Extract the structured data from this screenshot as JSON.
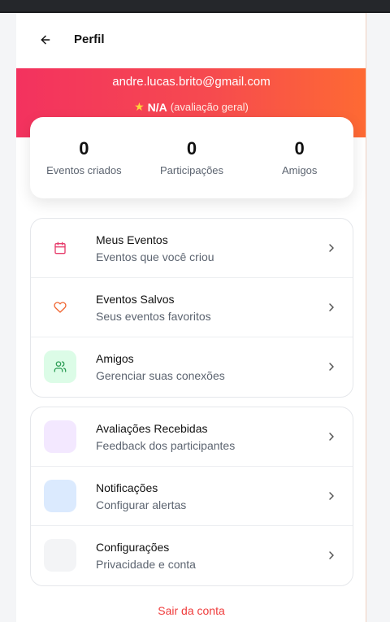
{
  "header": {
    "title": "Perfil",
    "back_icon": "arrow-left-icon"
  },
  "profile": {
    "email": "andre.lucas.brito@gmail.com",
    "rating_value": "N/A",
    "rating_label": "(avaliação geral)"
  },
  "stats": [
    {
      "value": "0",
      "label": "Eventos criados"
    },
    {
      "value": "0",
      "label": "Participações"
    },
    {
      "value": "0",
      "label": "Amigos"
    }
  ],
  "menu_group_1": [
    {
      "title": "Meus Eventos",
      "subtitle": "Eventos que você criou",
      "icon": "calendar-icon",
      "color": "#e63c6b",
      "bg": "#ffffff"
    },
    {
      "title": "Eventos Salvos",
      "subtitle": "Seus eventos favoritos",
      "icon": "heart-icon",
      "color": "#f0642f",
      "bg": "#ffffff"
    },
    {
      "title": "Amigos",
      "subtitle": "Gerenciar suas conexões",
      "icon": "users-icon",
      "color": "#2f9e57",
      "bg": "#dcfce7"
    }
  ],
  "menu_group_2": [
    {
      "title": "Avaliações Recebidas",
      "subtitle": "Feedback dos participantes",
      "icon": "star-icon",
      "bg": "#f3e8ff"
    },
    {
      "title": "Notificações",
      "subtitle": "Configurar alertas",
      "icon": "bell-icon",
      "bg": "#dbeafe"
    },
    {
      "title": "Configurações",
      "subtitle": "Privacidade e conta",
      "icon": "settings-icon",
      "bg": "#f3f4f6"
    }
  ],
  "logout_label": "Sair da conta",
  "colors": {
    "accent_start": "#f3325f",
    "accent_end": "#fe6a33",
    "danger": "#ef3b3b"
  }
}
